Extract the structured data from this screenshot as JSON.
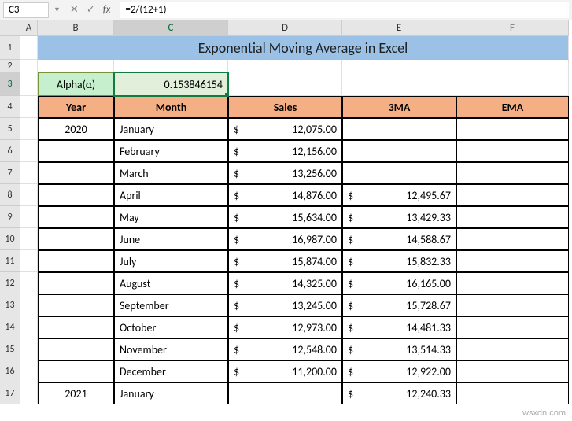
{
  "formula_bar": {
    "cell_ref": "C3",
    "formula": "=2/(12+1)"
  },
  "columns": [
    "A",
    "B",
    "C",
    "D",
    "E",
    "F"
  ],
  "col_widths": {
    "A": 22,
    "B": 97,
    "C": 145,
    "D": 145,
    "E": 145,
    "F": 143
  },
  "row_count": 17,
  "row_heights": {
    "1": 30,
    "2": 16,
    "3": 30,
    "default": 28
  },
  "title": "Exponential Moving Average in Excel",
  "alpha_label": "Alpha(α)",
  "alpha_value": "0.153846154",
  "headers": {
    "year": "Year",
    "month": "Month",
    "sales": "Sales",
    "ma": "3MA",
    "ema": "EMA"
  },
  "rows": [
    {
      "year": "2020",
      "month": "January",
      "sales": "12,075.00",
      "ma": "",
      "ema": ""
    },
    {
      "year": "",
      "month": "February",
      "sales": "12,156.00",
      "ma": "",
      "ema": ""
    },
    {
      "year": "",
      "month": "March",
      "sales": "13,256.00",
      "ma": "",
      "ema": ""
    },
    {
      "year": "",
      "month": "April",
      "sales": "14,876.00",
      "ma": "12,495.67",
      "ema": ""
    },
    {
      "year": "",
      "month": "May",
      "sales": "15,634.00",
      "ma": "13,429.33",
      "ema": ""
    },
    {
      "year": "",
      "month": "June",
      "sales": "16,987.00",
      "ma": "14,588.67",
      "ema": ""
    },
    {
      "year": "",
      "month": "July",
      "sales": "15,874.00",
      "ma": "15,832.33",
      "ema": ""
    },
    {
      "year": "",
      "month": "August",
      "sales": "14,325.00",
      "ma": "16,165.00",
      "ema": ""
    },
    {
      "year": "",
      "month": "September",
      "sales": "13,245.00",
      "ma": "15,728.67",
      "ema": ""
    },
    {
      "year": "",
      "month": "October",
      "sales": "12,973.00",
      "ma": "14,481.33",
      "ema": ""
    },
    {
      "year": "",
      "month": "November",
      "sales": "12,548.00",
      "ma": "13,514.33",
      "ema": ""
    },
    {
      "year": "",
      "month": "December",
      "sales": "11,200.00",
      "ma": "12,922.00",
      "ema": ""
    },
    {
      "year": "2021",
      "month": "January",
      "sales": "",
      "ma": "12,240.33",
      "ema": ""
    }
  ],
  "currency": "$",
  "watermark": "wsxdn.com"
}
